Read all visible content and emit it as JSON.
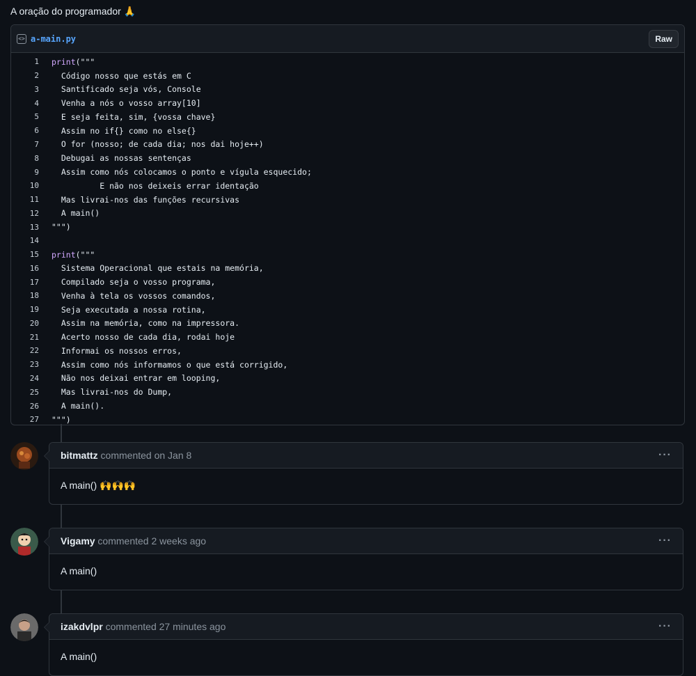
{
  "gist": {
    "description": "A oração do programador 🙏",
    "file_name": "a-main.py",
    "raw_label": "Raw",
    "code_icon": "code-file-icon"
  },
  "code_lines": [
    {
      "n": "1",
      "text": "print(\"\"\""
    },
    {
      "n": "2",
      "text": "  Código nosso que estás em C"
    },
    {
      "n": "3",
      "text": "  Santificado seja vós, Console"
    },
    {
      "n": "4",
      "text": "  Venha a nós o vosso array[10]"
    },
    {
      "n": "5",
      "text": "  E seja feita, sim, {vossa chave}"
    },
    {
      "n": "6",
      "text": "  Assim no if{} como no else{}"
    },
    {
      "n": "7",
      "text": "  O for (nosso; de cada dia; nos dai hoje++)"
    },
    {
      "n": "8",
      "text": "  Debugai as nossas sentenças"
    },
    {
      "n": "9",
      "text": "  Assim como nós colocamos o ponto e vígula esquecido;"
    },
    {
      "n": "10",
      "text": "          E não nos deixeis errar identação"
    },
    {
      "n": "11",
      "text": "  Mas livrai-nos das funções recursivas"
    },
    {
      "n": "12",
      "text": "  A main()"
    },
    {
      "n": "13",
      "text": "\"\"\")"
    },
    {
      "n": "14",
      "text": ""
    },
    {
      "n": "15",
      "text": "print(\"\"\""
    },
    {
      "n": "16",
      "text": "  Sistema Operacional que estais na memória,"
    },
    {
      "n": "17",
      "text": "  Compilado seja o vosso programa,"
    },
    {
      "n": "18",
      "text": "  Venha à tela os vossos comandos,"
    },
    {
      "n": "19",
      "text": "  Seja executada a nossa rotina,"
    },
    {
      "n": "20",
      "text": "  Assim na memória, como na impressora."
    },
    {
      "n": "21",
      "text": "  Acerto nosso de cada dia, rodai hoje"
    },
    {
      "n": "22",
      "text": "  Informai os nossos erros,"
    },
    {
      "n": "23",
      "text": "  Assim como nós informamos o que está corrigido,"
    },
    {
      "n": "24",
      "text": "  Não nos deixai entrar em looping,"
    },
    {
      "n": "25",
      "text": "  Mas livrai-nos do Dump,"
    },
    {
      "n": "26",
      "text": "  A main()."
    },
    {
      "n": "27",
      "text": "\"\"\")"
    }
  ],
  "comments": [
    {
      "author": "bitmattz",
      "meta": " commented on Jan 8",
      "body": "A main() 🙌🙌🙌",
      "menu": "···"
    },
    {
      "author": "Vigamy",
      "meta": " commented 2 weeks ago",
      "body": "A main()",
      "menu": "···"
    },
    {
      "author": "izakdvlpr",
      "meta": " commented 27 minutes ago",
      "body": "A main()",
      "menu": "···"
    }
  ]
}
